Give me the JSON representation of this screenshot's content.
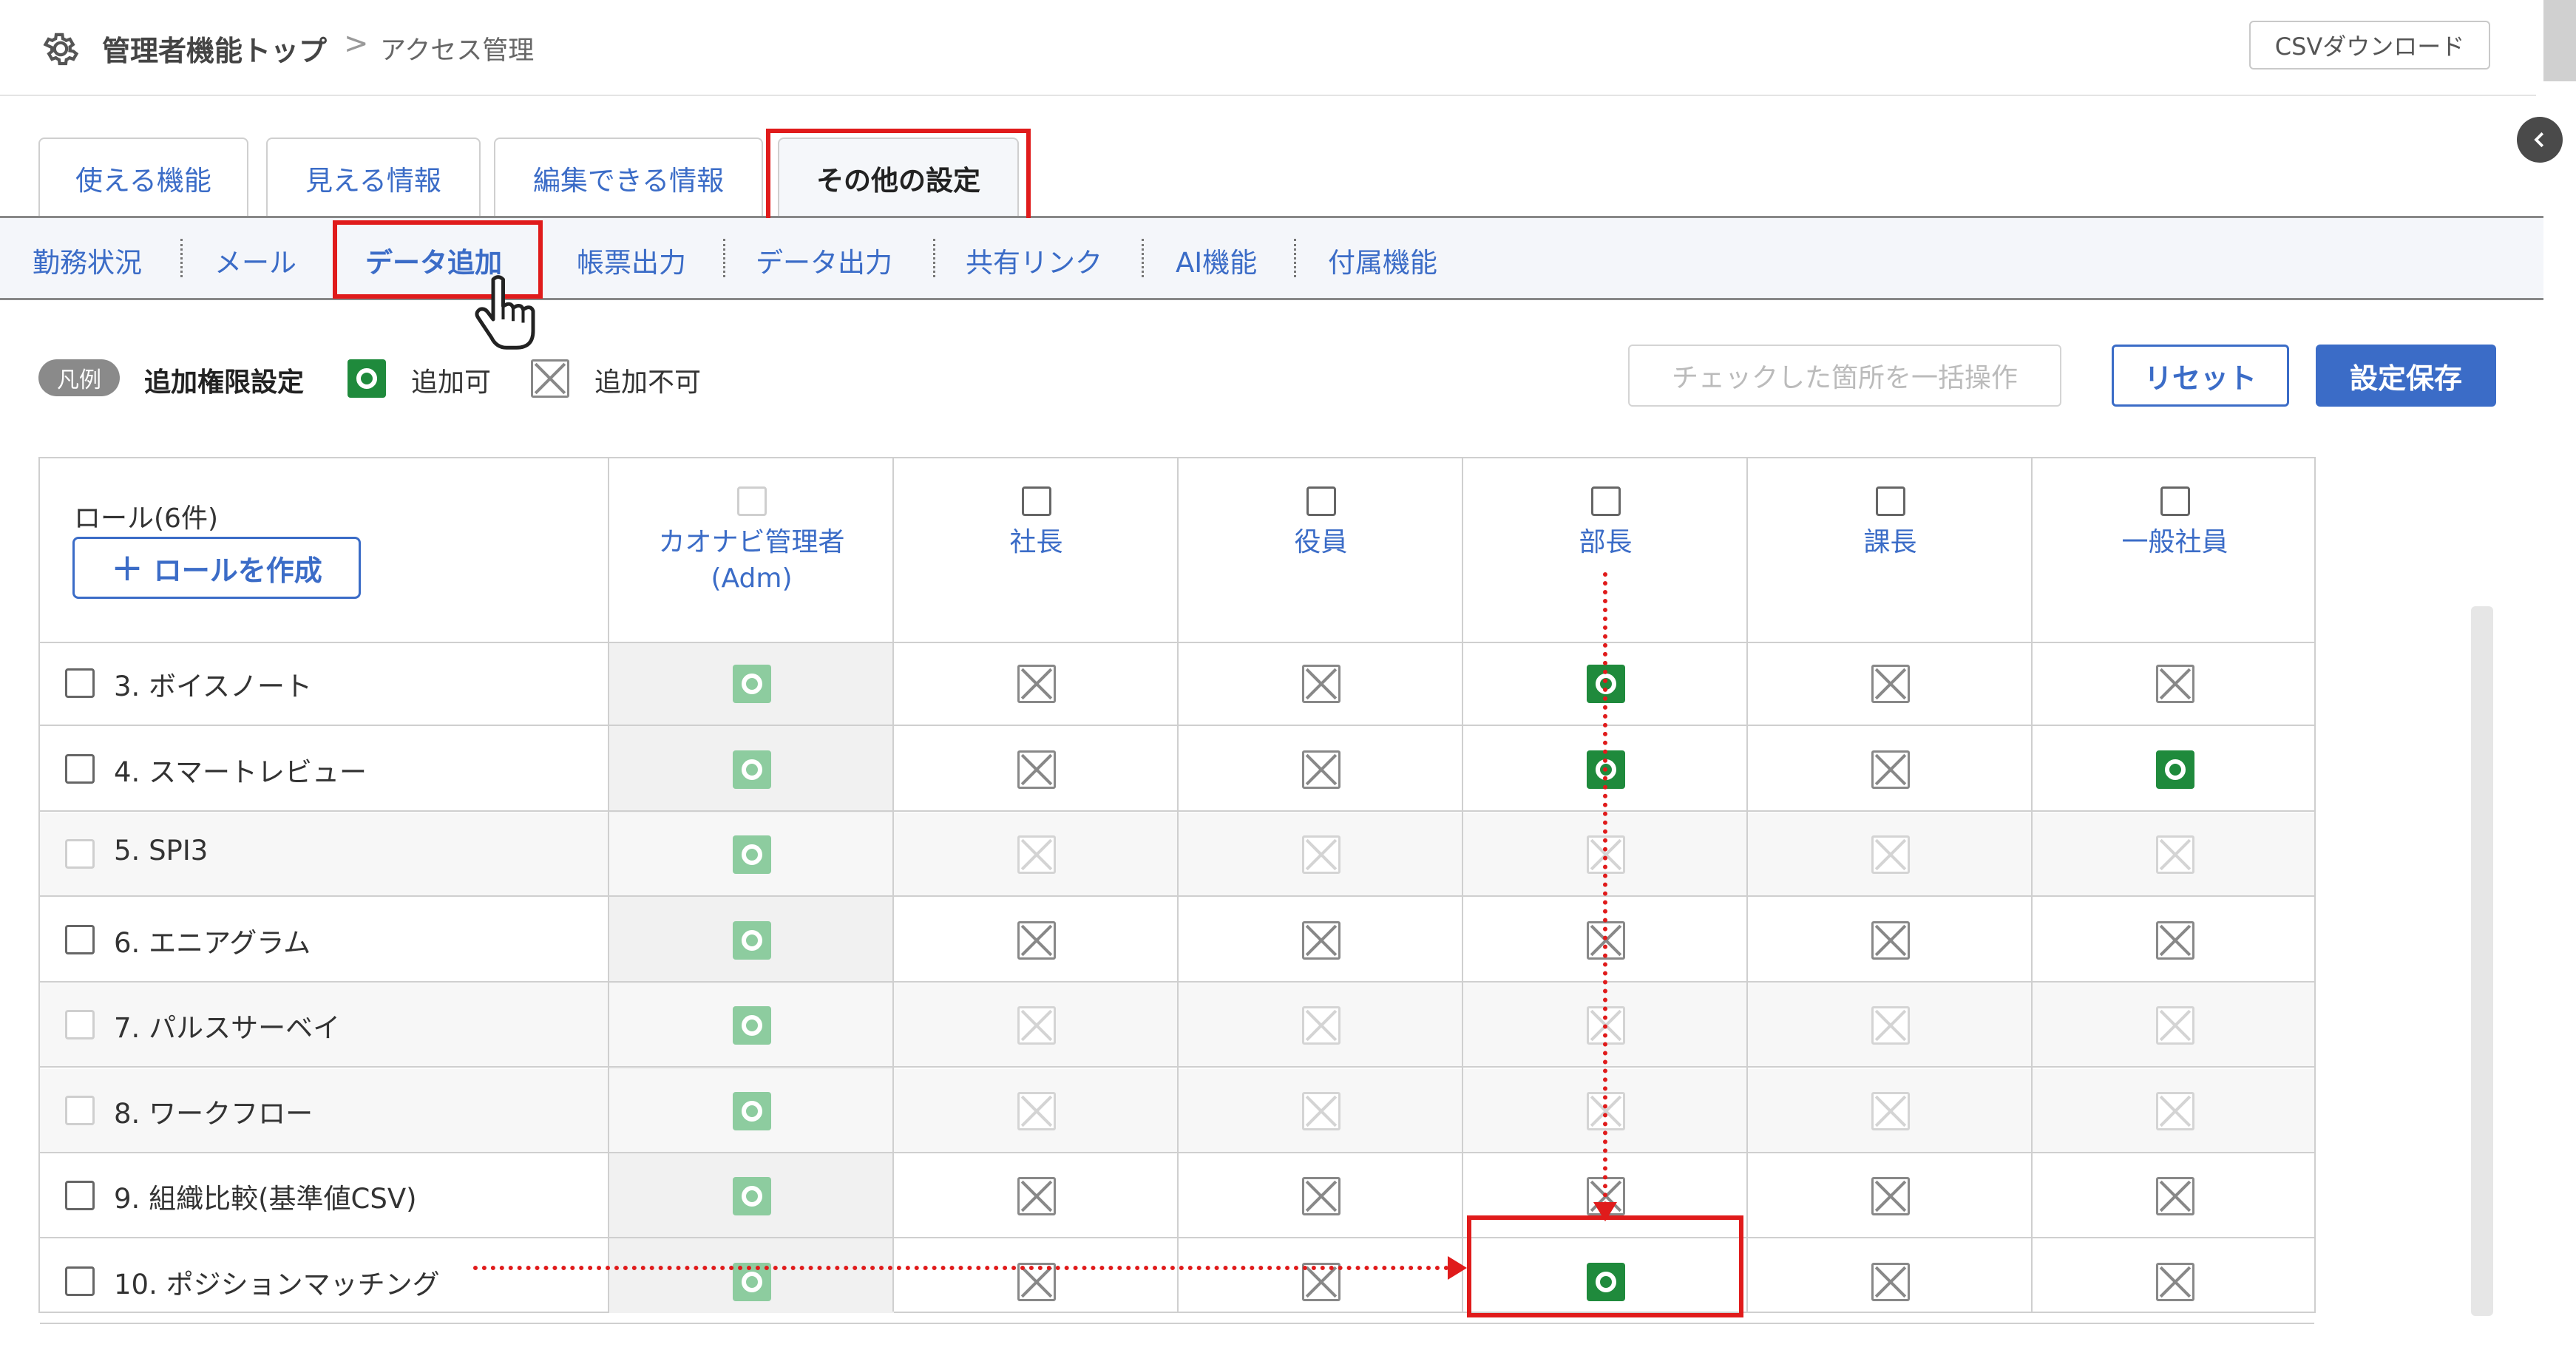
{
  "header": {
    "breadcrumb_main": "管理者機能トップ",
    "breadcrumb_sep": ">",
    "breadcrumb_sub": "アクセス管理",
    "csv_button": "CSVダウンロード"
  },
  "tabs": [
    {
      "label": "使える機能",
      "active": false
    },
    {
      "label": "見える情報",
      "active": false
    },
    {
      "label": "編集できる情報",
      "active": false
    },
    {
      "label": "その他の設定",
      "active": true
    }
  ],
  "subtabs": [
    {
      "label": "勤務状況"
    },
    {
      "label": "メール"
    },
    {
      "label": "データ追加",
      "active": true
    },
    {
      "label": "帳票出力"
    },
    {
      "label": "データ出力"
    },
    {
      "label": "共有リンク"
    },
    {
      "label": "AI機能"
    },
    {
      "label": "付属機能"
    }
  ],
  "legend": {
    "pill": "凡例",
    "title": "追加権限設定",
    "allow": "追加可",
    "deny": "追加不可"
  },
  "actions": {
    "bulk": "チェックした箇所を一括操作",
    "reset": "リセット",
    "save": "設定保存"
  },
  "table": {
    "role_count": "ロール(6件)",
    "create_role": "ロールを作成",
    "columns": [
      {
        "line1": "カオナビ管理者",
        "line2": "(Adm)"
      },
      {
        "line1": "社長",
        "line2": ""
      },
      {
        "line1": "役員",
        "line2": ""
      },
      {
        "line1": "部長",
        "line2": ""
      },
      {
        "line1": "課長",
        "line2": ""
      },
      {
        "line1": "一般社員",
        "line2": ""
      }
    ],
    "rows": [
      {
        "label": "3. ボイスノート",
        "disabled": false,
        "cells": [
          "ok",
          "ng",
          "ng",
          "ok",
          "ng",
          "ng"
        ]
      },
      {
        "label": "4. スマートレビュー",
        "disabled": false,
        "cells": [
          "ok",
          "ng",
          "ng",
          "ok",
          "ng",
          "ok"
        ]
      },
      {
        "label": "5. SPI3",
        "disabled": true,
        "cells": [
          "ok",
          "ng",
          "ng",
          "ng",
          "ng",
          "ng"
        ]
      },
      {
        "label": "6. エニアグラム",
        "disabled": false,
        "cells": [
          "ok",
          "ng",
          "ng",
          "ng",
          "ng",
          "ng"
        ]
      },
      {
        "label": "7. パルスサーベイ",
        "disabled": true,
        "cells": [
          "ok",
          "ng",
          "ng",
          "ng",
          "ng",
          "ng"
        ]
      },
      {
        "label": "8. ワークフロー",
        "disabled": true,
        "cells": [
          "ok",
          "ng",
          "ng",
          "ng",
          "ng",
          "ng"
        ]
      },
      {
        "label": "9. 組織比較(基準値CSV)",
        "disabled": false,
        "cells": [
          "ok",
          "ng",
          "ng",
          "ng",
          "ng",
          "ng"
        ]
      },
      {
        "label": "10. ポジションマッチング",
        "disabled": false,
        "cells": [
          "ok",
          "ng",
          "ng",
          "ok",
          "ng",
          "ng"
        ]
      }
    ]
  },
  "colors": {
    "accent": "#3b6cc7",
    "allow_green": "#1f8a3c",
    "highlight_red": "#e01b1b"
  }
}
